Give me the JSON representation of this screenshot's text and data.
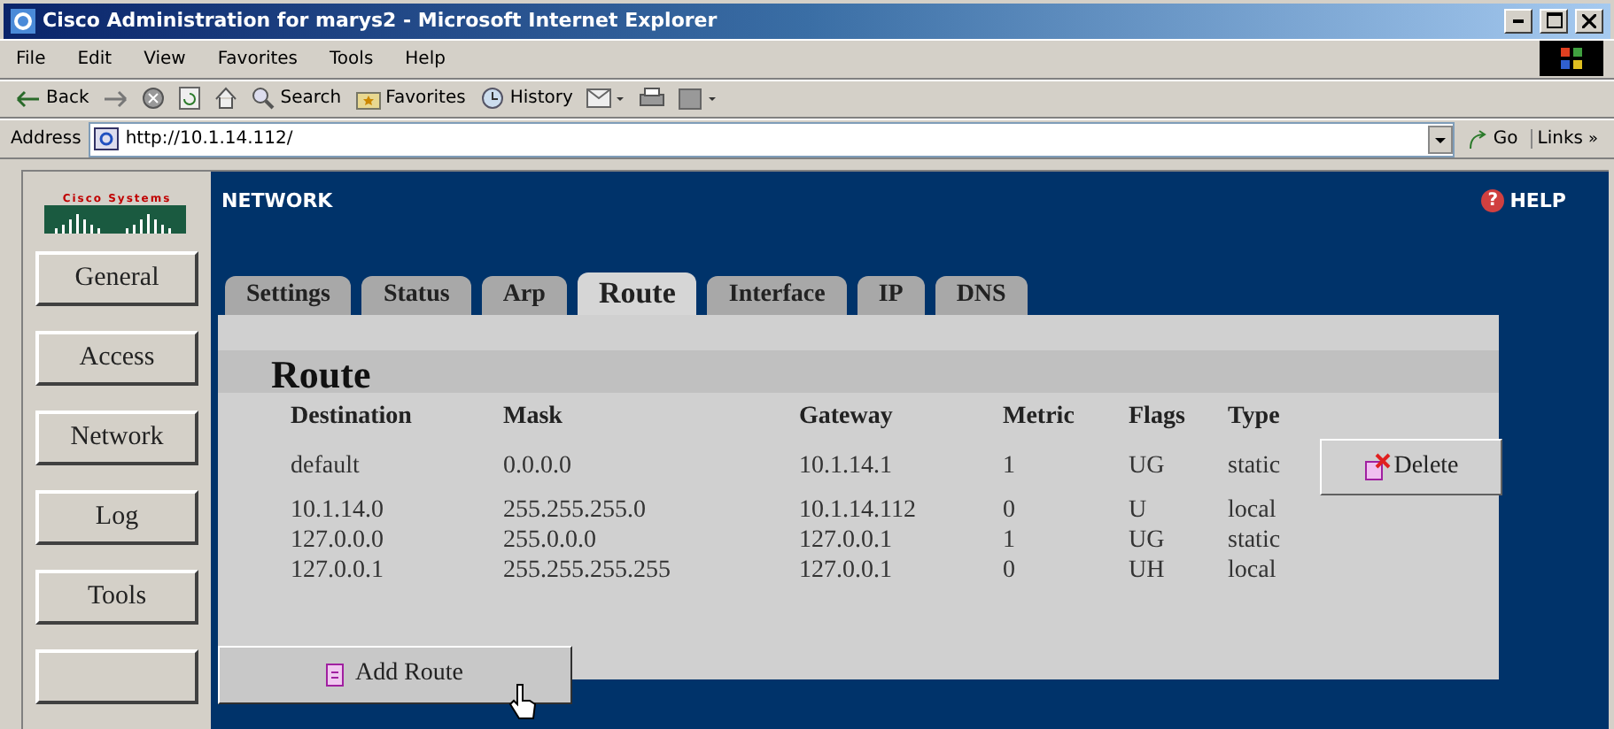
{
  "window": {
    "title": "Cisco Administration for marys2 - Microsoft Internet Explorer"
  },
  "menu": [
    "File",
    "Edit",
    "View",
    "Favorites",
    "Tools",
    "Help"
  ],
  "toolbar": [
    {
      "kind": "back",
      "label": "Back"
    },
    {
      "kind": "forward"
    },
    {
      "kind": "stop"
    },
    {
      "kind": "refresh"
    },
    {
      "kind": "home"
    },
    {
      "kind": "search",
      "label": "Search"
    },
    {
      "kind": "favorites",
      "label": "Favorites"
    },
    {
      "kind": "history",
      "label": "History"
    },
    {
      "kind": "mail"
    },
    {
      "kind": "print"
    },
    {
      "kind": "edit"
    }
  ],
  "address": {
    "label": "Address",
    "value": "http://10.1.14.112/",
    "go": "Go",
    "links": "Links",
    "links_chevron": "»"
  },
  "logo": {
    "text": "Cisco Systems"
  },
  "sidebar": {
    "items": [
      {
        "label": "General"
      },
      {
        "label": "Access"
      },
      {
        "label": "Network"
      },
      {
        "label": "Log"
      },
      {
        "label": "Tools"
      }
    ]
  },
  "header": {
    "section": "NETWORK",
    "help_icon": "?",
    "help": "HELP"
  },
  "tabs": [
    {
      "label": "Settings",
      "selected": false
    },
    {
      "label": "Status",
      "selected": false
    },
    {
      "label": "Arp",
      "selected": false
    },
    {
      "label": "Route",
      "selected": true
    },
    {
      "label": "Interface",
      "selected": false
    },
    {
      "label": "IP",
      "selected": false
    },
    {
      "label": "DNS",
      "selected": false
    }
  ],
  "panel": {
    "title": "Route",
    "table": {
      "columns": [
        "Destination",
        "Mask",
        "Gateway",
        "Metric",
        "Flags",
        "Type"
      ],
      "rows": [
        [
          "default",
          "0.0.0.0",
          "10.1.14.1",
          "1",
          "UG",
          "static"
        ],
        [
          "10.1.14.0",
          "255.255.255.0",
          "10.1.14.112",
          "0",
          "U",
          "local"
        ],
        [
          "127.0.0.0",
          "255.0.0.0",
          "127.0.0.1",
          "1",
          "UG",
          "static"
        ],
        [
          "127.0.0.1",
          "255.255.255.255",
          "127.0.0.1",
          "0",
          "UH",
          "local"
        ]
      ]
    },
    "delete_button": "Delete",
    "add_button": "Add Route"
  }
}
